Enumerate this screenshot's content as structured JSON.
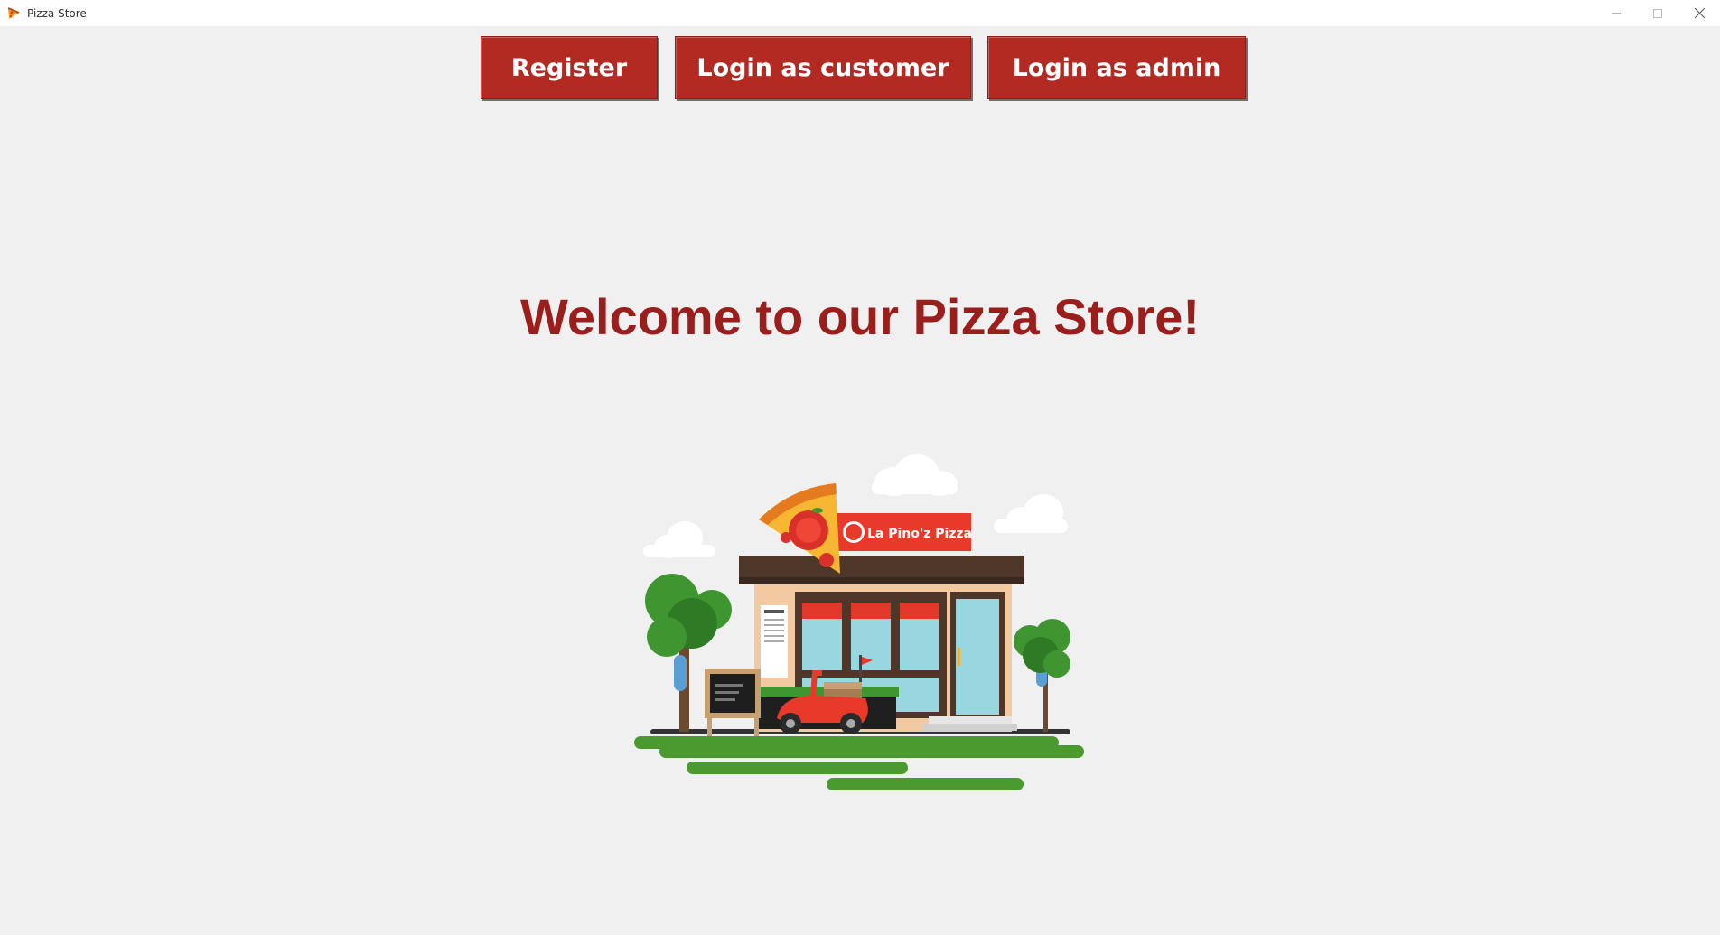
{
  "window": {
    "title": "Pizza Store",
    "icon": "pizza-slice-icon",
    "controls": [
      "minimize-icon",
      "maximize-icon",
      "close-icon"
    ]
  },
  "nav": {
    "register_label": "Register",
    "customer_login_label": "Login as customer",
    "admin_login_label": "Login as admin"
  },
  "welcome_text": "Welcome to our Pizza Store!",
  "illustration": {
    "sign_text": "La Pino'z Pizza",
    "logo_text": "La Pino'z Pizza"
  },
  "colors": {
    "button_bg": "#b22a22",
    "heading": "#9a1f1c",
    "background": "#f0f0f0"
  }
}
